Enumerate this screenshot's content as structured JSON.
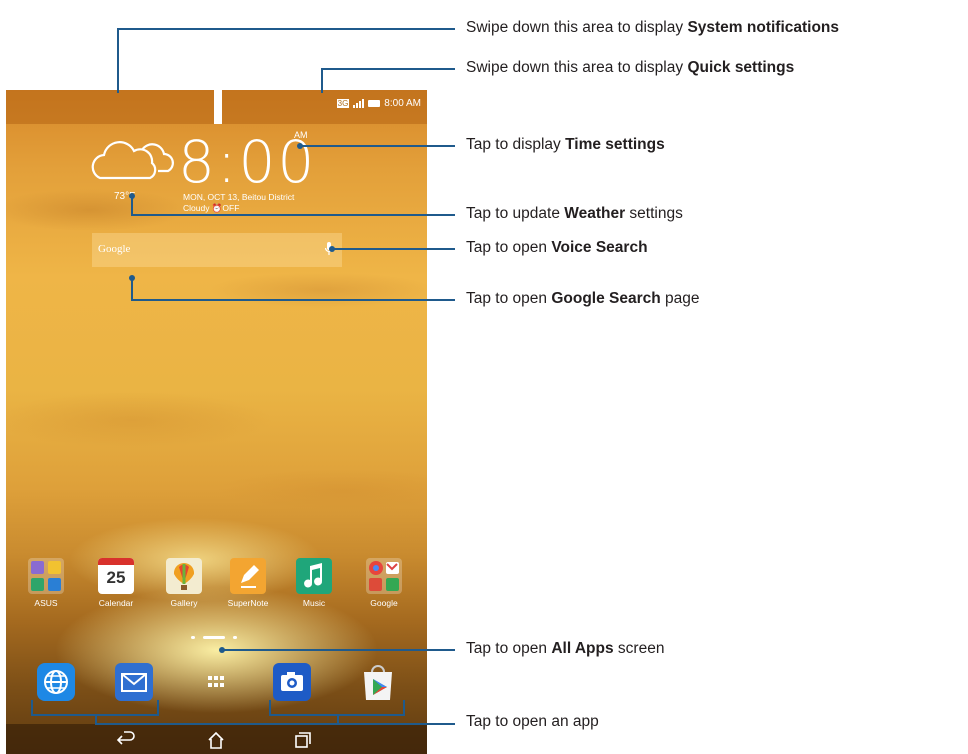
{
  "status_bar": {
    "time": "8:00 AM"
  },
  "clock": {
    "time": "8:00",
    "ampm": "AM",
    "date_line": "MON, OCT 13, Beitou District",
    "weather_line": "Cloudy  ⏰OFF",
    "temperature": "73°F",
    "weather_icon": "cloud-icon"
  },
  "search": {
    "logo": "Google",
    "mic_icon": "microphone-icon"
  },
  "apps": [
    {
      "label": "ASUS",
      "icon": "folder-icon"
    },
    {
      "label": "Calendar",
      "icon": "calendar-icon",
      "badge": "25"
    },
    {
      "label": "Gallery",
      "icon": "gallery-icon"
    },
    {
      "label": "SuperNote",
      "icon": "pencil-icon"
    },
    {
      "label": "Music",
      "icon": "music-note-icon"
    },
    {
      "label": "Google",
      "icon": "folder-icon"
    }
  ],
  "dock": [
    {
      "icon": "globe-icon"
    },
    {
      "icon": "envelope-icon"
    },
    {
      "icon": "all-apps-grid-icon"
    },
    {
      "icon": "camera-icon"
    },
    {
      "icon": "play-store-icon"
    }
  ],
  "nav": {
    "back": "⮌",
    "home": "⌂",
    "recent": "□"
  },
  "callouts": [
    {
      "prefix": "Swipe down this area to display ",
      "bold": "System notifications",
      "suffix": ""
    },
    {
      "prefix": "Swipe down this area to display ",
      "bold": "Quick settings",
      "suffix": ""
    },
    {
      "prefix": "Tap to display ",
      "bold": "Time settings",
      "suffix": ""
    },
    {
      "prefix": "Tap to update ",
      "bold": "Weather",
      "suffix": " settings"
    },
    {
      "prefix": "Tap to open ",
      "bold": "Voice Search",
      "suffix": ""
    },
    {
      "prefix": "Tap to open ",
      "bold": "Google Search",
      "suffix": " page"
    },
    {
      "prefix": "Tap to open ",
      "bold": "All Apps",
      "suffix": " screen"
    },
    {
      "prefix": "Tap to open an app",
      "bold": "",
      "suffix": ""
    }
  ],
  "colors": {
    "line": "#1f5a8c",
    "text": "#231f20"
  }
}
